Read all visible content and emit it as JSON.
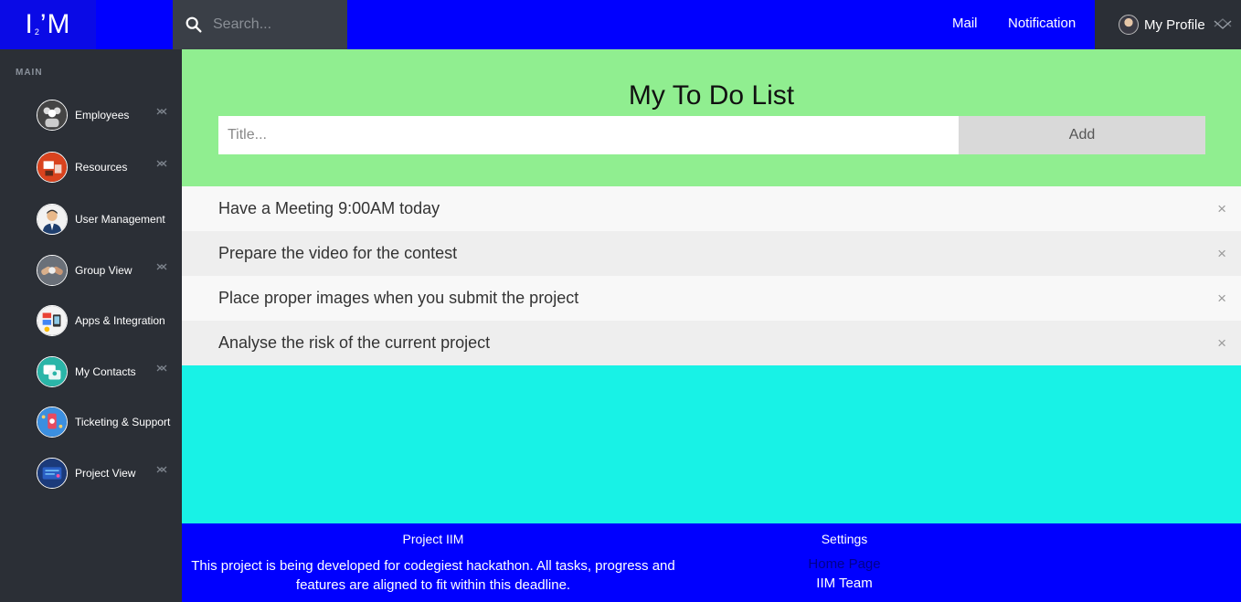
{
  "logo": {
    "brand_left": "I",
    "brand_sub": "2",
    "brand_right": "’M"
  },
  "search": {
    "placeholder": "Search..."
  },
  "nav": {
    "mail": "Mail",
    "notification": "Notification",
    "profile": "My Profile"
  },
  "sidebar": {
    "header": "MAIN",
    "items": [
      {
        "label": "Employees",
        "icon": "employees-icon",
        "color": "#444444"
      },
      {
        "label": "Resources",
        "icon": "resources-icon",
        "color": "#d9431e"
      },
      {
        "label": "User Management",
        "icon": "user-icon",
        "color": "#f2f2f2"
      },
      {
        "label": "Group View",
        "icon": "group-icon",
        "color": "#6a7079"
      },
      {
        "label": "Apps & Integration",
        "icon": "apps-icon",
        "color": "#f4f4f4"
      },
      {
        "label": "My Contacts",
        "icon": "contacts-icon",
        "color": "#2ab5a8"
      },
      {
        "label": "Ticketing & Support",
        "icon": "ticket-icon",
        "color": "#3b8fe0"
      },
      {
        "label": "Project View",
        "icon": "project-icon",
        "color": "#1b3a7a"
      }
    ]
  },
  "todo": {
    "title": "My To Do List",
    "input_placeholder": "Title...",
    "add_label": "Add",
    "close_glyph": "×",
    "items": [
      {
        "text": "Have a Meeting 9:00AM today"
      },
      {
        "text": "Prepare the video for the contest"
      },
      {
        "text": "Place proper images when you submit the project"
      },
      {
        "text": "Analyse the risk of the current project"
      }
    ]
  },
  "footer": {
    "project_title": "Project IIM",
    "description": "This project is being developed for codegiest hackathon. All tasks, progress and features are aligned to fit within this deadline.",
    "settings_title": "Settings",
    "links": [
      "Home Page",
      "IIM Team"
    ]
  },
  "colors": {
    "topbar": "#0000ff",
    "sidebar": "#2b2f36",
    "header_bg": "#90ee90",
    "content_bg": "#18f2e6",
    "footer": "#0000ff"
  }
}
